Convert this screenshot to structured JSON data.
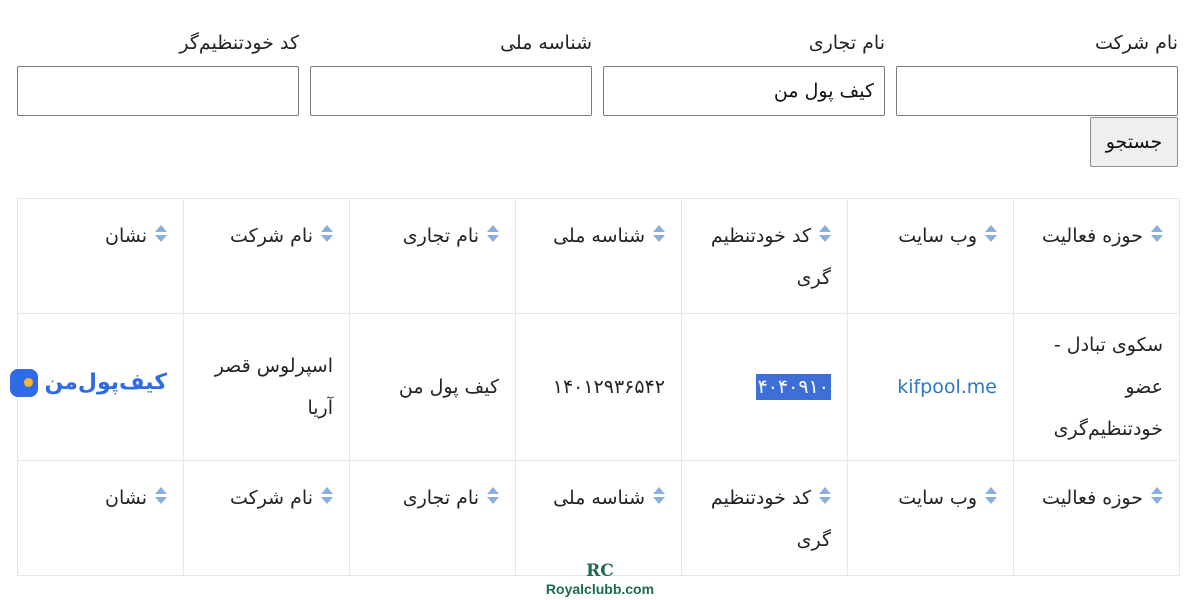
{
  "search": {
    "company_label": "نام شرکت",
    "company_value": "",
    "brand_label": "نام تجاری",
    "brand_value": "کیف پول من",
    "national_id_label": "شناسه ملی",
    "national_id_value": "",
    "code_label": "کد خودتنظیم‌گر",
    "code_value": "",
    "submit_label": "جستجو"
  },
  "table": {
    "headers": [
      "حوزه فعالیت",
      "وب سایت",
      "کد خودتنظیم گری",
      "شناسه ملی",
      "نام تجاری",
      "نام شرکت",
      "نشان"
    ],
    "footer_headers": [
      "حوزه فعالیت",
      "وب سایت",
      "کد خودتنظیم گری",
      "شناسه ملی",
      "نام تجاری",
      "نام شرکت",
      "نشان"
    ],
    "rows": [
      {
        "field": "سکوی تبادل - عضو خودتنظیم‌گری",
        "website": "kifpool.me",
        "code": "۴۰۴۰۹۱۰",
        "national_id": "۱۴۰۱۲۹۳۶۵۴۲",
        "brand": "کیف پول من",
        "company": "اسپرلوس قصر آریا",
        "logo_text": "کیف‌پول‌من",
        "logo_icon": "kifpool-logo-icon"
      }
    ]
  },
  "watermark": {
    "mark": "RC",
    "text": "Royalclubb.com"
  },
  "colors": {
    "link": "#2c78c6",
    "highlight": "#3e6fd8",
    "sort_icon": "#8aaee0",
    "logo_blue": "#2f6be4",
    "watermark": "#1d6b4c"
  }
}
